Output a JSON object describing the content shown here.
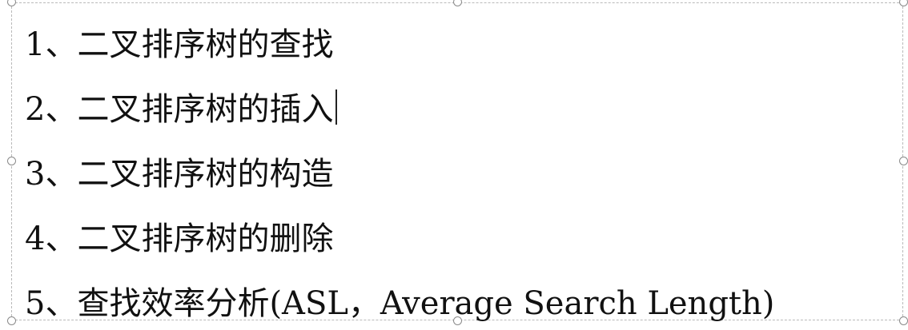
{
  "slide": {
    "items": [
      {
        "label": "1、二叉排序树的查找"
      },
      {
        "label": "2、二叉排序树的插入"
      },
      {
        "label": "3、二叉排序树的构造"
      },
      {
        "label": "4、二叉排序树的删除"
      },
      {
        "label": "5、查找效率分析(ASL，Average Search Length)"
      }
    ]
  }
}
